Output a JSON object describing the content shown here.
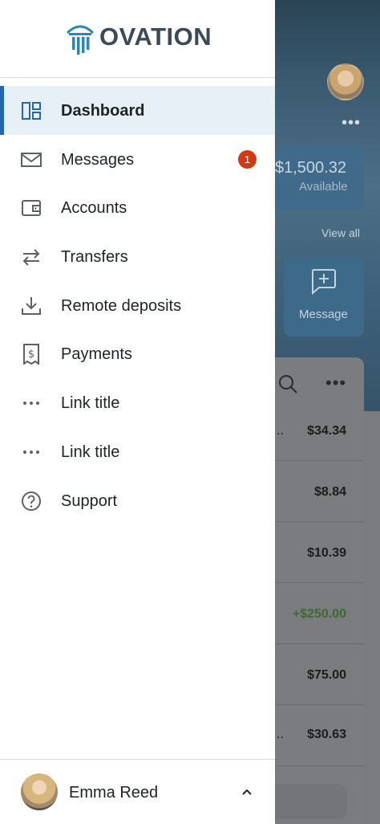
{
  "brand": {
    "name": "OVATION",
    "logo_icon": "column-logo-icon",
    "color": "#3c4a57",
    "accent": "#2e86b5"
  },
  "nav": {
    "items": [
      {
        "label": "Dashboard",
        "icon": "dashboard-icon",
        "active": true
      },
      {
        "label": "Messages",
        "icon": "envelope-icon",
        "badge": "1"
      },
      {
        "label": "Accounts",
        "icon": "wallet-icon"
      },
      {
        "label": "Transfers",
        "icon": "transfer-arrows-icon"
      },
      {
        "label": "Remote deposits",
        "icon": "download-icon"
      },
      {
        "label": "Payments",
        "icon": "receipt-dollar-icon"
      },
      {
        "label": "Link title",
        "icon": "more-horizontal-icon"
      },
      {
        "label": "Link title",
        "icon": "more-horizontal-icon"
      },
      {
        "label": "Support",
        "icon": "help-circle-icon"
      }
    ],
    "active_color": "#2467a8",
    "badge_color": "#cf3b14"
  },
  "footer": {
    "user_name": "Emma Reed",
    "chevron": "chevron-up-icon"
  },
  "background": {
    "balance": "$1,500.32",
    "balance_label": "Available",
    "view_all": "View all",
    "message_button": "Message",
    "transactions": [
      "$34.34",
      "$8.84",
      "$10.39",
      "+$250.00",
      "$75.00",
      "$30.63"
    ]
  }
}
